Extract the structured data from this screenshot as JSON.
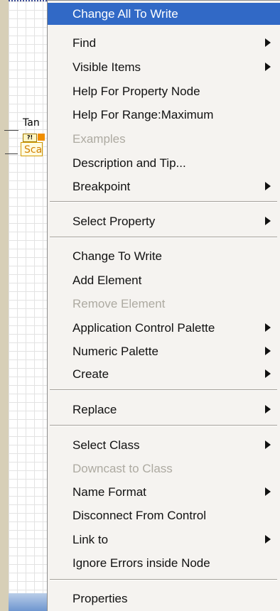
{
  "canvas": {
    "node": {
      "label": "Tan",
      "tag_text": "?!",
      "property_text": "Sca"
    }
  },
  "menu": {
    "items": [
      {
        "label": "Change All To Write",
        "submenu": false,
        "disabled": false,
        "highlighted": true
      },
      {
        "label": "Find",
        "submenu": true,
        "disabled": false,
        "highlighted": false
      },
      {
        "label": "Visible Items",
        "submenu": true,
        "disabled": false,
        "highlighted": false
      },
      {
        "label": "Help For Property Node",
        "submenu": false,
        "disabled": false,
        "highlighted": false
      },
      {
        "label": "Help For Range:Maximum",
        "submenu": false,
        "disabled": false,
        "highlighted": false
      },
      {
        "label": "Examples",
        "submenu": false,
        "disabled": true,
        "highlighted": false
      },
      {
        "label": "Description and Tip...",
        "submenu": false,
        "disabled": false,
        "highlighted": false
      },
      {
        "label": "Breakpoint",
        "submenu": true,
        "disabled": false,
        "highlighted": false
      },
      {
        "label": "Select Property",
        "submenu": true,
        "disabled": false,
        "highlighted": false
      },
      {
        "label": "Change To Write",
        "submenu": false,
        "disabled": false,
        "highlighted": false
      },
      {
        "label": "Add Element",
        "submenu": false,
        "disabled": false,
        "highlighted": false
      },
      {
        "label": "Remove Element",
        "submenu": false,
        "disabled": true,
        "highlighted": false
      },
      {
        "label": "Application Control Palette",
        "submenu": true,
        "disabled": false,
        "highlighted": false
      },
      {
        "label": "Numeric Palette",
        "submenu": true,
        "disabled": false,
        "highlighted": false
      },
      {
        "label": "Create",
        "submenu": true,
        "disabled": false,
        "highlighted": false
      },
      {
        "label": "Replace",
        "submenu": true,
        "disabled": false,
        "highlighted": false
      },
      {
        "label": "Select Class",
        "submenu": true,
        "disabled": false,
        "highlighted": false
      },
      {
        "label": "Downcast to Class",
        "submenu": false,
        "disabled": true,
        "highlighted": false
      },
      {
        "label": "Name Format",
        "submenu": true,
        "disabled": false,
        "highlighted": false
      },
      {
        "label": "Disconnect From Control",
        "submenu": false,
        "disabled": false,
        "highlighted": false
      },
      {
        "label": "Link to",
        "submenu": true,
        "disabled": false,
        "highlighted": false
      },
      {
        "label": "Ignore Errors inside Node",
        "submenu": false,
        "disabled": false,
        "highlighted": false
      },
      {
        "label": "Properties",
        "submenu": false,
        "disabled": false,
        "highlighted": false
      }
    ]
  },
  "colors": {
    "highlight": "#3169c6",
    "disabled_text": "#adaaa1",
    "menu_background": "#f5f3f0"
  }
}
